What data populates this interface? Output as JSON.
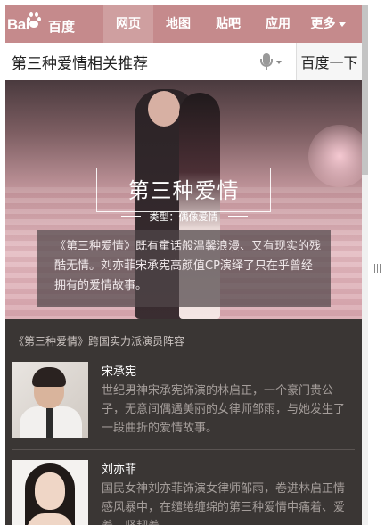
{
  "logo": {
    "en": "Bai",
    "cn": "百度"
  },
  "nav": {
    "items": [
      {
        "label": "网页",
        "active": true
      },
      {
        "label": "地图",
        "active": false
      },
      {
        "label": "贴吧",
        "active": false
      },
      {
        "label": "应用",
        "active": false
      }
    ],
    "more_label": "更多"
  },
  "search": {
    "value": "第三种爱情相关推荐",
    "button_label": "百度一下"
  },
  "hero": {
    "title": "第三种爱情",
    "subtitle": "类型：偶像爱情",
    "description": "《第三种爱情》既有童话般温馨浪漫、又有现实的残酷无情。刘亦菲宋承宪高颜值CP演绎了只在乎曾经拥有的爱情故事。"
  },
  "section_title": "《第三种爱情》跨国实力派演员阵容",
  "actors": [
    {
      "name": "宋承宪",
      "description": "世纪男神宋承宪饰演的林启正，一个豪门贵公子，无意间偶遇美丽的女律师邹雨，与她发生了一段曲折的爱情故事。"
    },
    {
      "name": "刘亦菲",
      "description": "国民女神刘亦菲饰演女律师邹雨，卷进林启正情感风暴中，在缱绻缠绵的第三种爱情中痛着、爱着、坚韧着。"
    }
  ],
  "colors": {
    "topbar": "#c58a8c",
    "page_bg": "#3a3634"
  }
}
